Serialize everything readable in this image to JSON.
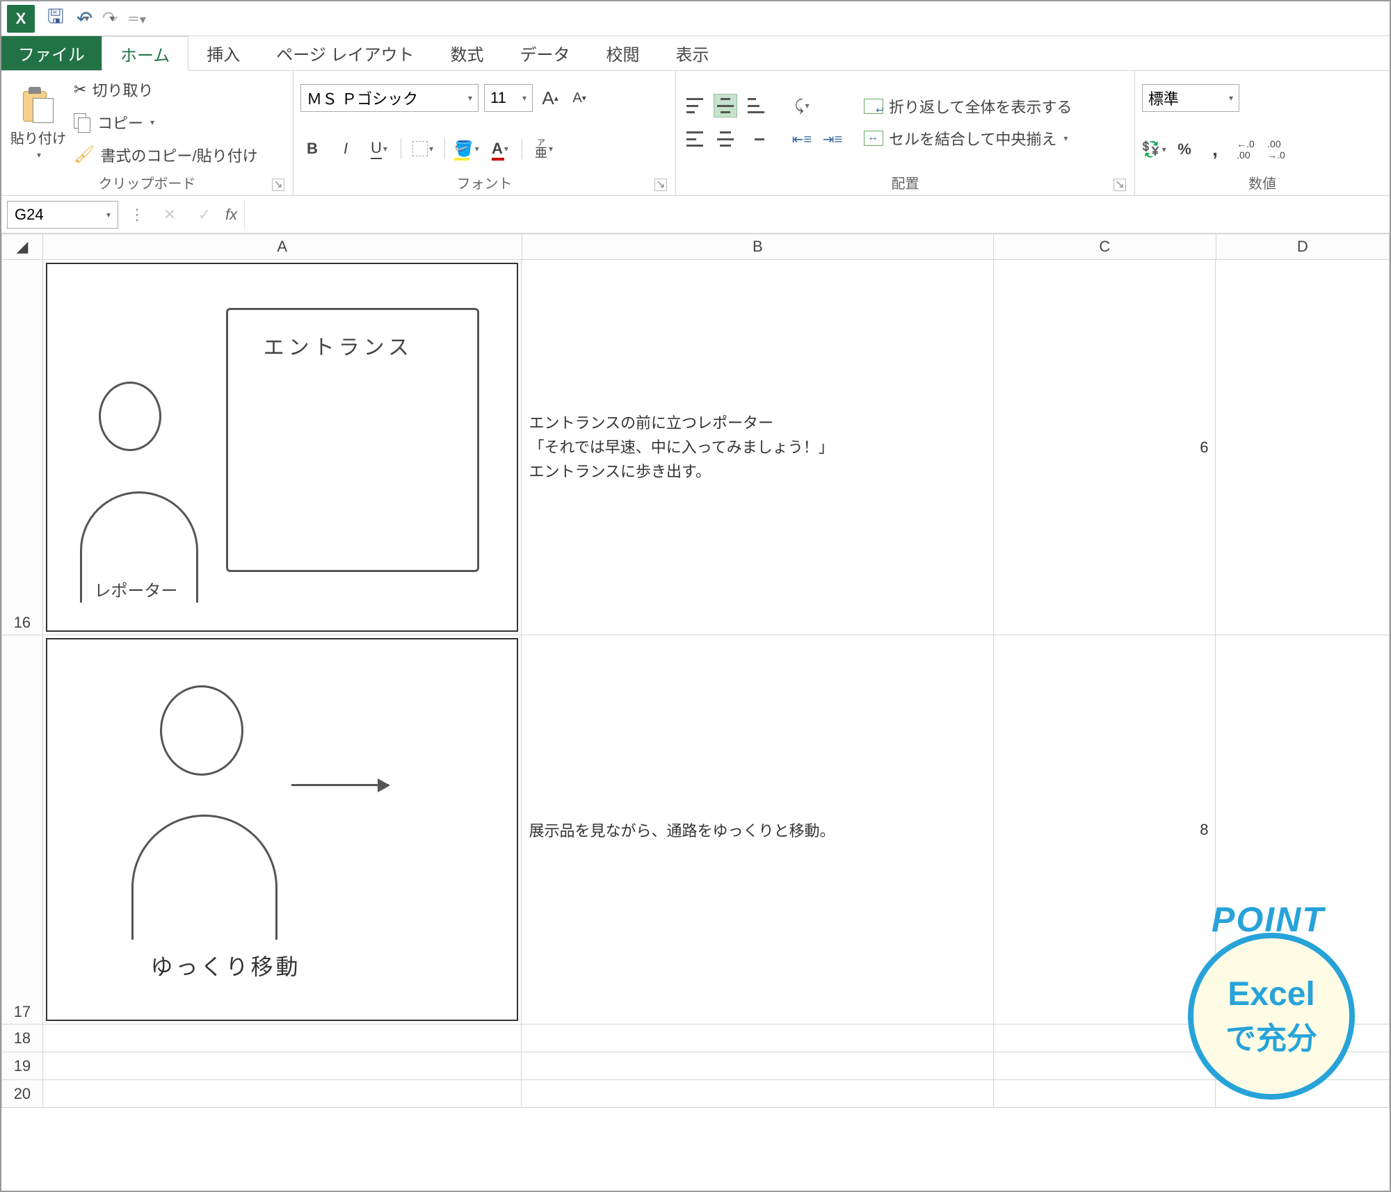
{
  "qat": {
    "save": "保存",
    "undo": "元に戻す",
    "redo": "やり直し"
  },
  "tabs": {
    "file": "ファイル",
    "home": "ホーム",
    "insert": "挿入",
    "pageLayout": "ページ レイアウト",
    "formulas": "数式",
    "data": "データ",
    "review": "校閲",
    "view": "表示"
  },
  "ribbon": {
    "clipboard": {
      "paste": "貼り付け",
      "cut": "切り取り",
      "copy": "コピー",
      "formatPainter": "書式のコピー/貼り付け",
      "groupLabel": "クリップボード"
    },
    "font": {
      "name": "ＭＳ Ｐゴシック",
      "size": "11",
      "increase": "A",
      "decrease": "A",
      "bold": "B",
      "italic": "I",
      "underline": "U",
      "ruby": "ア亜",
      "groupLabel": "フォント"
    },
    "alignment": {
      "wrap": "折り返して全体を表示する",
      "merge": "セルを結合して中央揃え",
      "groupLabel": "配置"
    },
    "number": {
      "format": "標準",
      "percent": "%",
      "comma": ",",
      "inc": ".0→.00",
      "dec": ".00→.0",
      "groupLabel": "数値"
    }
  },
  "formulaBar": {
    "nameBox": "G24",
    "fx": "fx",
    "value": ""
  },
  "columns": {
    "A": "A",
    "B": "B",
    "C": "C",
    "D": "D"
  },
  "rows": [
    {
      "num": "16",
      "sketchTitle": "エントランス",
      "sketchLabel": "レポーター",
      "b": "エントランスの前に立つレポーター\n「それでは早速、中に入ってみましょう！」\nエントランスに歩き出す。",
      "c": "6"
    },
    {
      "num": "17",
      "sketchLabel": "ゆっくり移動",
      "b": "展示品を見ながら、通路をゆっくりと移動。",
      "c": "8"
    },
    {
      "num": "18"
    },
    {
      "num": "19"
    },
    {
      "num": "20"
    }
  ],
  "badge": {
    "point": "POINT",
    "line1": "Excel",
    "line2": "で充分"
  }
}
